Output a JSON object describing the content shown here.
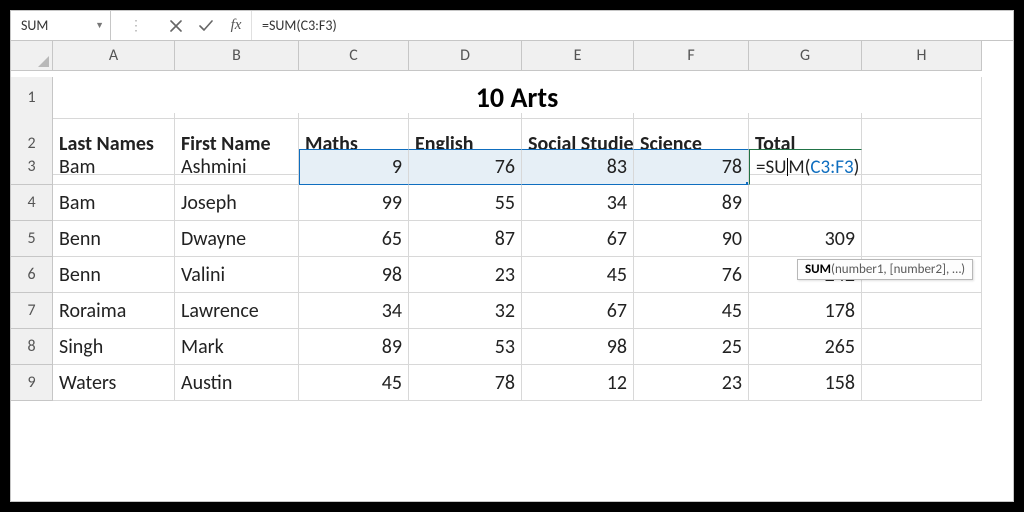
{
  "formula_bar": {
    "name_box": "SUM",
    "fx_label": "fx",
    "value": "=SUM(C3:F3)"
  },
  "columns": [
    "A",
    "B",
    "C",
    "D",
    "E",
    "F",
    "G",
    "H"
  ],
  "title": "10 Arts",
  "headers": {
    "last": "Last Names",
    "first": "First Name",
    "maths": "Maths",
    "english": "English",
    "social": "Social Studies",
    "science": "Science",
    "total": "Total"
  },
  "rows": [
    {
      "n": 3,
      "last": "Bam",
      "first": "Ashmini",
      "maths": 9,
      "english": 76,
      "social": 83,
      "science": 78,
      "total": "=SUM(C3:F3)"
    },
    {
      "n": 4,
      "last": "Bam",
      "first": "Joseph",
      "maths": 99,
      "english": 55,
      "social": 34,
      "science": 89,
      "total": ""
    },
    {
      "n": 5,
      "last": "Benn",
      "first": "Dwayne",
      "maths": 65,
      "english": 87,
      "social": 67,
      "science": 90,
      "total": 309
    },
    {
      "n": 6,
      "last": "Benn",
      "first": "Valini",
      "maths": 98,
      "english": 23,
      "social": 45,
      "science": 76,
      "total": 242
    },
    {
      "n": 7,
      "last": "Roraima",
      "first": "Lawrence",
      "maths": 34,
      "english": 32,
      "social": 67,
      "science": 45,
      "total": 178
    },
    {
      "n": 8,
      "last": "Singh",
      "first": "Mark",
      "maths": 89,
      "english": 53,
      "social": 98,
      "science": 25,
      "total": 265
    },
    {
      "n": 9,
      "last": "Waters",
      "first": "Austin",
      "maths": 45,
      "english": 78,
      "social": 12,
      "science": 23,
      "total": 158
    }
  ],
  "active_cell": {
    "address": "G3",
    "display_pre": "=SU",
    "display_mid": "M(",
    "display_ref": "C3:F3",
    "display_post": ")"
  },
  "tooltip": {
    "func": "SUM",
    "args": "(number1, [number2], …)"
  },
  "chart_data": {
    "type": "table",
    "title": "10 Arts",
    "columns": [
      "Last Names",
      "First Name",
      "Maths",
      "English",
      "Social Studies",
      "Science",
      "Total"
    ],
    "rows": [
      [
        "Bam",
        "Ashmini",
        9,
        76,
        83,
        78,
        null
      ],
      [
        "Bam",
        "Joseph",
        99,
        55,
        34,
        89,
        null
      ],
      [
        "Benn",
        "Dwayne",
        65,
        87,
        67,
        90,
        309
      ],
      [
        "Benn",
        "Valini",
        98,
        23,
        45,
        76,
        242
      ],
      [
        "Roraima",
        "Lawrence",
        34,
        32,
        67,
        45,
        178
      ],
      [
        "Singh",
        "Mark",
        89,
        53,
        98,
        25,
        265
      ],
      [
        "Waters",
        "Austin",
        45,
        78,
        12,
        23,
        158
      ]
    ]
  }
}
